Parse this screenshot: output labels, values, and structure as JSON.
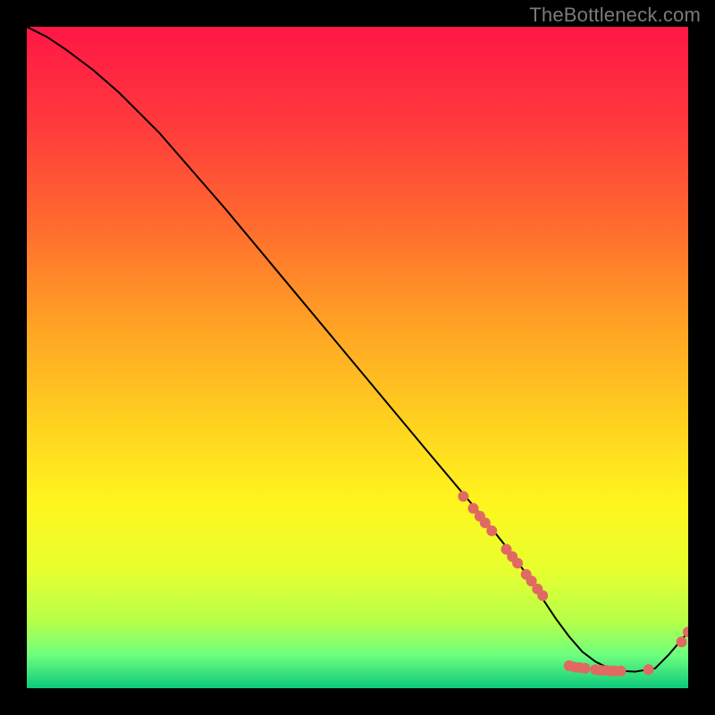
{
  "watermark": "TheBottleneck.com",
  "chart_data": {
    "type": "line",
    "title": "",
    "xlabel": "",
    "ylabel": "",
    "xlim": [
      0,
      100
    ],
    "ylim": [
      0,
      100
    ],
    "grid": false,
    "legend": false,
    "background_gradient": {
      "stops": [
        {
          "pos": 0.0,
          "color": "#ff1646"
        },
        {
          "pos": 0.15,
          "color": "#ff3b3c"
        },
        {
          "pos": 0.3,
          "color": "#ff6b2e"
        },
        {
          "pos": 0.45,
          "color": "#ffa225"
        },
        {
          "pos": 0.6,
          "color": "#ffd21f"
        },
        {
          "pos": 0.72,
          "color": "#fff51e"
        },
        {
          "pos": 0.82,
          "color": "#e8ff2f"
        },
        {
          "pos": 0.9,
          "color": "#b6ff4a"
        },
        {
          "pos": 0.95,
          "color": "#6dff7e"
        },
        {
          "pos": 1.0,
          "color": "#0cc97b"
        }
      ]
    },
    "series": [
      {
        "name": "bottleneck-curve",
        "color": "#000000",
        "x": [
          0,
          3,
          6,
          10,
          14,
          20,
          30,
          40,
          50,
          60,
          68,
          72,
          75,
          78,
          80,
          82,
          84,
          86,
          88,
          90,
          92,
          95,
          97,
          100
        ],
        "y": [
          100,
          98.5,
          96.5,
          93.5,
          90,
          84,
          72.5,
          60.5,
          48.5,
          36.5,
          27,
          22,
          18,
          13.5,
          10.5,
          7.8,
          5.5,
          4.0,
          3.0,
          2.6,
          2.5,
          3.0,
          5.0,
          8.5
        ]
      }
    ],
    "markers": {
      "color": "#e06a61",
      "radius": 6,
      "points": [
        {
          "x": 66,
          "y": 29
        },
        {
          "x": 67.5,
          "y": 27.2
        },
        {
          "x": 68.5,
          "y": 26.0
        },
        {
          "x": 69.3,
          "y": 25.0
        },
        {
          "x": 70.3,
          "y": 23.8
        },
        {
          "x": 72.5,
          "y": 21.0
        },
        {
          "x": 73.4,
          "y": 19.9
        },
        {
          "x": 74.2,
          "y": 18.9
        },
        {
          "x": 75.5,
          "y": 17.2
        },
        {
          "x": 76.3,
          "y": 16.2
        },
        {
          "x": 77.2,
          "y": 15.0
        },
        {
          "x": 78.0,
          "y": 14.0
        },
        {
          "x": 82.0,
          "y": 3.4
        },
        {
          "x": 82.8,
          "y": 3.2
        },
        {
          "x": 83.6,
          "y": 3.1
        },
        {
          "x": 84.4,
          "y": 3.0
        },
        {
          "x": 86.0,
          "y": 2.8
        },
        {
          "x": 86.8,
          "y": 2.7
        },
        {
          "x": 87.6,
          "y": 2.7
        },
        {
          "x": 88.3,
          "y": 2.6
        },
        {
          "x": 89.0,
          "y": 2.6
        },
        {
          "x": 89.8,
          "y": 2.6
        },
        {
          "x": 94.0,
          "y": 2.8
        },
        {
          "x": 99.0,
          "y": 7.0
        },
        {
          "x": 100.0,
          "y": 8.5
        }
      ]
    }
  }
}
